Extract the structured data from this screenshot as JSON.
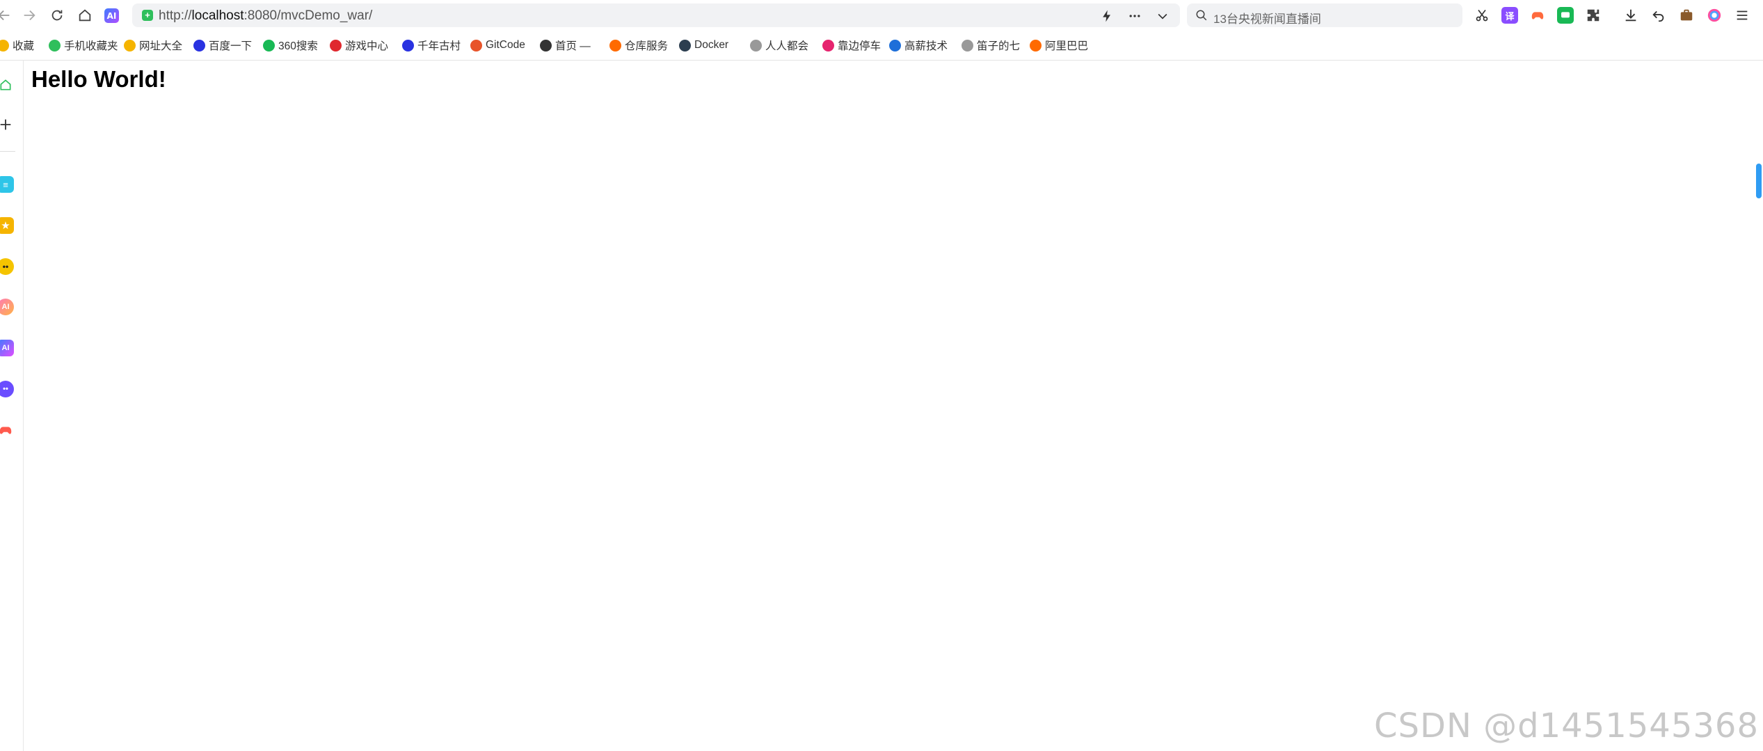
{
  "browser": {
    "url_prefix": "http://",
    "url_host": "localhost",
    "url_rest": ":8080/mvcDemo_war/",
    "search_placeholder": "13台央视新闻直播间",
    "ai_label": "AI"
  },
  "bookmarks": [
    {
      "label": "收藏",
      "icon": "star-icon",
      "color": "#f5b400"
    },
    {
      "label": "手机收藏夹",
      "icon": "phone-icon",
      "color": "#2fbf5c"
    },
    {
      "label": "网址大全",
      "icon": "globe-icon",
      "color": "#f5b400"
    },
    {
      "label": "百度一下",
      "icon": "baidu-icon",
      "color": "#2932e1"
    },
    {
      "label": "360搜索",
      "icon": "search-360-icon",
      "color": "#19b955"
    },
    {
      "label": "游戏中心",
      "icon": "game-icon",
      "color": "#e0282e"
    },
    {
      "label": "千年古村",
      "icon": "baidu-icon",
      "color": "#2932e1"
    },
    {
      "label": "GitCode",
      "icon": "gitcode-icon",
      "color": "#e8542a"
    },
    {
      "label": "首页 —",
      "icon": "github-icon",
      "color": "#333333"
    },
    {
      "label": "仓库服务",
      "icon": "aliyun-icon",
      "color": "#ff6a00"
    },
    {
      "label": "Docker",
      "icon": "docker-icon",
      "color": "#2c3e50"
    },
    {
      "label": "人人都会",
      "icon": "globe-icon",
      "color": "#999999"
    },
    {
      "label": "靠边停车",
      "icon": "play-icon",
      "color": "#e6246f"
    },
    {
      "label": "高薪技术",
      "icon": "edge-icon",
      "color": "#1e6fd9"
    },
    {
      "label": "笛子的七",
      "icon": "globe-icon",
      "color": "#999999"
    },
    {
      "label": "阿里巴巴",
      "icon": "aliyun-icon",
      "color": "#ff6a00"
    }
  ],
  "page": {
    "heading": "Hello World!"
  },
  "watermark": "CSDN @d1451545368",
  "colors": {
    "accent": "#2f9cf3",
    "secure": "#2fbf5c"
  }
}
